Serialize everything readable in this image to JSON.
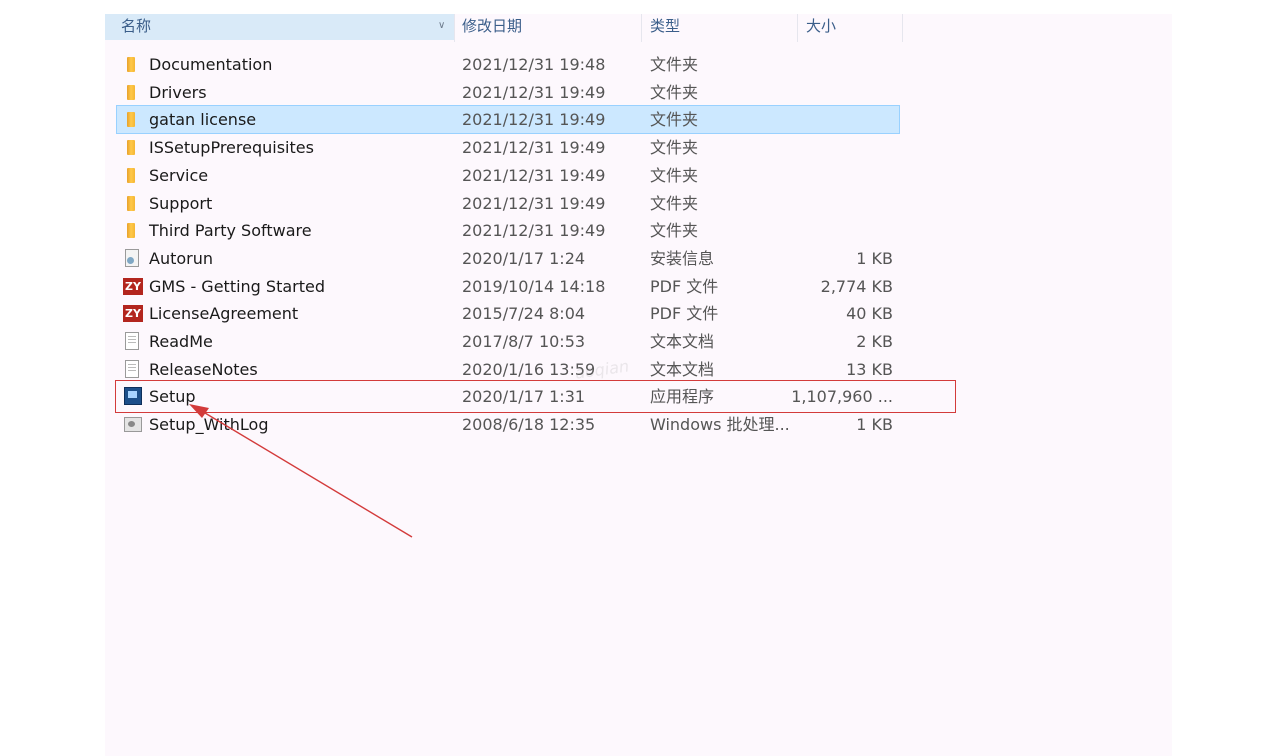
{
  "columns": {
    "name": "名称",
    "date": "修改日期",
    "type": "类型",
    "size": "大小"
  },
  "files": [
    {
      "name": "Documentation",
      "date": "2021/12/31 19:48",
      "type": "文件夹",
      "size": "",
      "icon": "folder-icon"
    },
    {
      "name": "Drivers",
      "date": "2021/12/31 19:49",
      "type": "文件夹",
      "size": "",
      "icon": "folder-icon"
    },
    {
      "name": "gatan license",
      "date": "2021/12/31 19:49",
      "type": "文件夹",
      "size": "",
      "icon": "folder-icon",
      "selected": true
    },
    {
      "name": "ISSetupPrerequisites",
      "date": "2021/12/31 19:49",
      "type": "文件夹",
      "size": "",
      "icon": "folder-icon"
    },
    {
      "name": "Service",
      "date": "2021/12/31 19:49",
      "type": "文件夹",
      "size": "",
      "icon": "folder-icon"
    },
    {
      "name": "Support",
      "date": "2021/12/31 19:49",
      "type": "文件夹",
      "size": "",
      "icon": "folder-icon"
    },
    {
      "name": "Third Party Software",
      "date": "2021/12/31 19:49",
      "type": "文件夹",
      "size": "",
      "icon": "folder-icon"
    },
    {
      "name": "Autorun",
      "date": "2020/1/17 1:24",
      "type": "安装信息",
      "size": "1 KB",
      "icon": "autorun-icon"
    },
    {
      "name": "GMS - Getting Started",
      "date": "2019/10/14 14:18",
      "type": "PDF 文件",
      "size": "2,774 KB",
      "icon": "pdf-icon"
    },
    {
      "name": "LicenseAgreement",
      "date": "2015/7/24 8:04",
      "type": "PDF 文件",
      "size": "40 KB",
      "icon": "pdf-icon"
    },
    {
      "name": "ReadMe",
      "date": "2017/8/7 10:53",
      "type": "文本文档",
      "size": "2 KB",
      "icon": "text-file-icon"
    },
    {
      "name": "ReleaseNotes",
      "date": "2020/1/16 13:59",
      "type": "文本文档",
      "size": "13 KB",
      "icon": "text-file-icon"
    },
    {
      "name": "Setup",
      "date": "2020/1/17 1:31",
      "type": "应用程序",
      "size": "1,107,960 ...",
      "icon": "setup-app-icon"
    },
    {
      "name": "Setup_WithLog",
      "date": "2008/6/18 12:35",
      "type": "Windows 批处理...",
      "size": "1 KB",
      "icon": "batch-file-icon"
    }
  ],
  "pdf_icon_text": "ZY",
  "watermark": "aoqian",
  "colors": {
    "selection": "#cce8ff",
    "header_highlight": "#d9eaf8",
    "annotation": "#d33b3b"
  }
}
